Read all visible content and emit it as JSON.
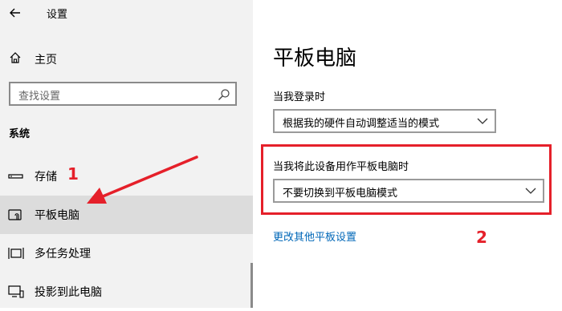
{
  "app": {
    "title": "设置"
  },
  "sidebar": {
    "home_label": "主页",
    "search_placeholder": "查找设置",
    "group_title": "系统",
    "items": [
      {
        "label": "存储",
        "icon": "storage-icon"
      },
      {
        "label": "平板电脑",
        "icon": "tablet-icon",
        "selected": true
      },
      {
        "label": "多任务处理",
        "icon": "multitasking-icon"
      },
      {
        "label": "投影到此电脑",
        "icon": "project-icon"
      }
    ]
  },
  "main": {
    "title": "平板电脑",
    "login_label": "当我登录时",
    "login_value": "根据我的硬件自动调整适当的模式",
    "tablet_use_label": "当我将此设备用作平板电脑时",
    "tablet_use_value": "不要切换到平板电脑模式",
    "more_link": "更改其他平板设置"
  },
  "annotations": {
    "marker_1": "1",
    "marker_2": "2",
    "color": "#e5202a"
  },
  "colors": {
    "sidebar_bg": "#f2f2f2",
    "selected_bg": "#dcdcdc",
    "link": "#0067b8"
  }
}
